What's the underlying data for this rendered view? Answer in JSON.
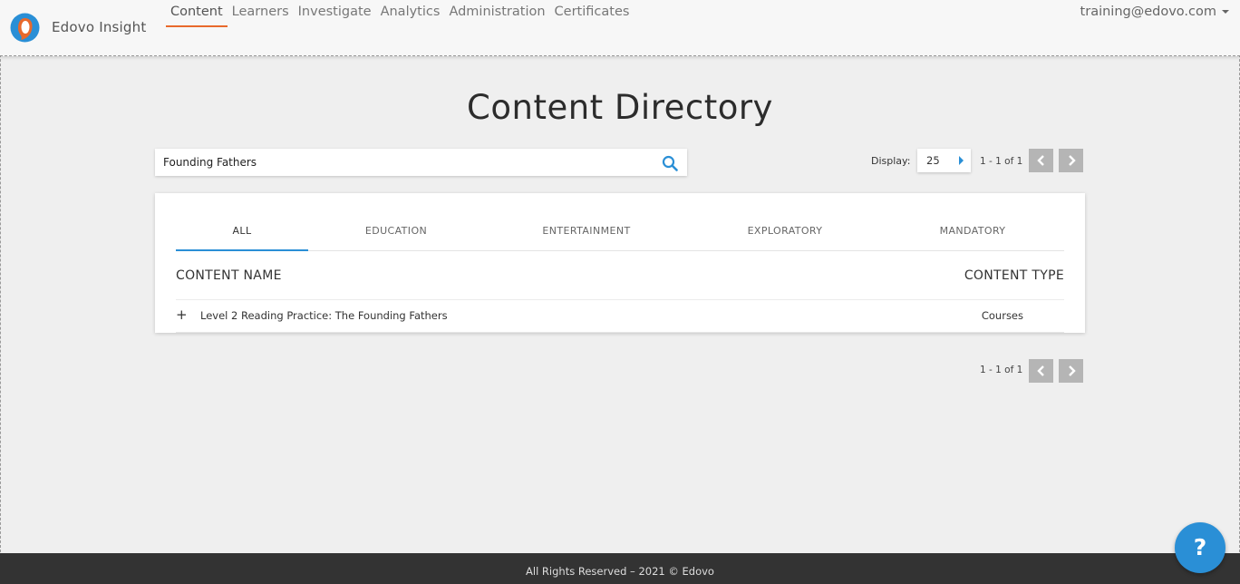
{
  "app": {
    "brand": "Edovo Insight",
    "user": "training@edovo.com",
    "nav": [
      "Content",
      "Learners",
      "Investigate",
      "Analytics",
      "Administration",
      "Certificates"
    ],
    "active_nav": "Content",
    "accent_color": "#e8692c",
    "primary_color": "#2a8fd6"
  },
  "page": {
    "title": "Content Directory"
  },
  "search": {
    "value": "Founding Fathers",
    "icon": "search-icon"
  },
  "display": {
    "label": "Display:",
    "value": "25"
  },
  "pagination": {
    "top_range": "1 - 1 of 1",
    "bottom_range": "1 - 1 of 1"
  },
  "tabs": [
    "ALL",
    "EDUCATION",
    "ENTERTAINMENT",
    "EXPLORATORY",
    "MANDATORY"
  ],
  "active_tab": "ALL",
  "table": {
    "columns": [
      "CONTENT NAME",
      "CONTENT TYPE"
    ],
    "rows": [
      {
        "expand": "+",
        "name": "Level 2 Reading Practice: The Founding Fathers",
        "type": "Courses"
      }
    ]
  },
  "footer": {
    "text": "All Rights Reserved – 2021 © Edovo"
  },
  "help": {
    "label": "?"
  }
}
